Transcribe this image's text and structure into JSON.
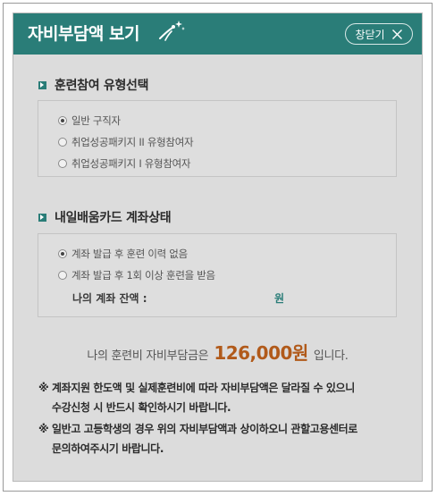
{
  "header": {
    "title": "자비부담액 보기",
    "close_label": "창닫기"
  },
  "training_type": {
    "section_title": "훈련참여 유형선택",
    "options": [
      {
        "label": "일반 구직자",
        "checked": true
      },
      {
        "label": "취업성공패키지 II 유형참여자",
        "checked": false
      },
      {
        "label": "취업성공패키지 I 유형참여자",
        "checked": false
      }
    ]
  },
  "card_status": {
    "section_title": "내일배움카드 계좌상태",
    "options": [
      {
        "label": "계좌 발급 후 훈련 이력 없음",
        "checked": true
      },
      {
        "label": "계좌 발급 후 1회 이상 훈련을 받음",
        "checked": false
      }
    ],
    "balance_label": "나의 계좌 잔액 :",
    "balance_unit": "원"
  },
  "summary": {
    "prefix": "나의 훈련비 자비부담금은",
    "amount": "126,000원",
    "suffix": "입니다."
  },
  "notes": [
    {
      "line1": "※ 계좌지원 한도액 및 실제훈련비에 따라 자비부담액은 달라질 수 있으니",
      "line2": "수강신청 시 반드시 확인하시기 바랍니다."
    },
    {
      "line1": "※ 일반고 고등학생의 경우 위의 자비부담액과 상이하오니 관할고용센터로",
      "line2": "문의하여주시기 바랍니다."
    }
  ],
  "colors": {
    "header": "#2a7d78",
    "amount": "#b15a1a",
    "panel": "#dcdcdc"
  },
  "icons": {
    "title_decoration": "sparkle-figure-icon",
    "close": "close-icon",
    "section_bullet": "arrow-bullet-icon"
  }
}
